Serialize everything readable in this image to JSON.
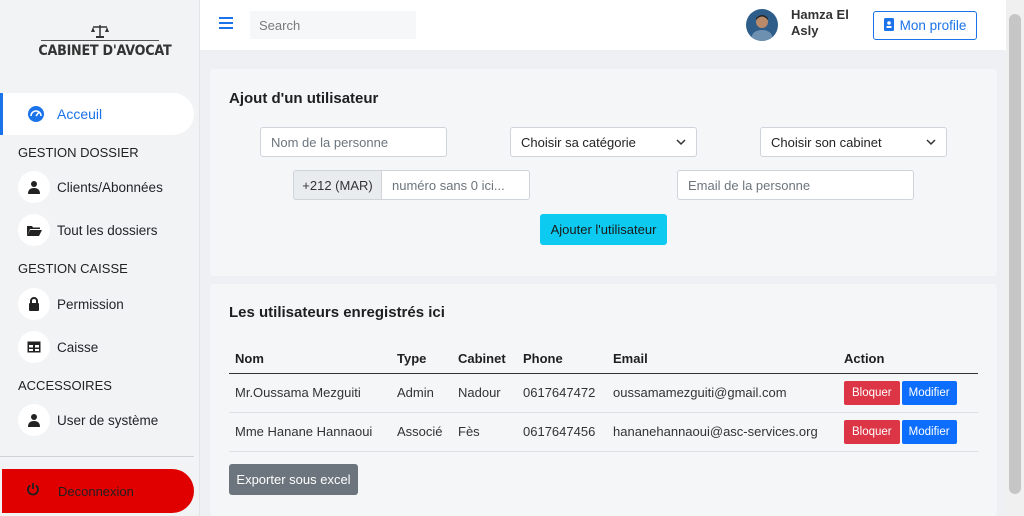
{
  "logo": {
    "text": "CABINET D'AVOCAT",
    "icon": "scales-icon"
  },
  "sidebar": {
    "active": {
      "label": "Acceuil",
      "icon": "dashboard-icon"
    },
    "sections": [
      {
        "title": "GESTION DOSSIER",
        "items": [
          {
            "label": "Clients/Abonnées",
            "icon": "user-icon"
          },
          {
            "label": "Tout les dossiers",
            "icon": "folder-open-icon"
          }
        ]
      },
      {
        "title": "GESTION CAISSE",
        "items": [
          {
            "label": "Permission",
            "icon": "lock-icon"
          },
          {
            "label": "Caisse",
            "icon": "table-icon"
          }
        ]
      },
      {
        "title": "ACCESSOIRES",
        "items": [
          {
            "label": "User de système",
            "icon": "user-icon"
          }
        ]
      }
    ],
    "logout": {
      "label": "Deconnexion",
      "icon": "power-icon"
    }
  },
  "topbar": {
    "search_placeholder": "Search",
    "user_name": "Hamza El Asly",
    "profile_label": "Mon profile",
    "accent": "#1a73e8"
  },
  "form": {
    "title": "Ajout d'un utilisateur",
    "name_placeholder": "Nom de la personne",
    "category_selected": "Choisir sa catégorie",
    "cabinet_selected": "Choisir son cabinet",
    "phone_prefix": "+212 (MAR)",
    "phone_placeholder": "numéro sans 0 ici...",
    "email_placeholder": "Email de la personne",
    "submit_label": "Ajouter l'utilisateur"
  },
  "users": {
    "title": "Les utilisateurs enregistrés ici",
    "columns": [
      "Nom",
      "Type",
      "Cabinet",
      "Phone",
      "Email",
      "Action"
    ],
    "rows": [
      {
        "nom": "Mr.Oussama Mezguiti",
        "type": "Admin",
        "cabinet": "Nadour",
        "phone": "0617647472",
        "email": "oussamamezguiti@gmail.com",
        "block": "Bloquer",
        "modify": "Modifier"
      },
      {
        "nom": "Mme Hanane Hannaoui",
        "type": "Associé",
        "cabinet": "Fès",
        "phone": "0617647456",
        "email": "hananehannaoui@asc-services.org",
        "block": "Bloquer",
        "modify": "Modifier"
      }
    ],
    "export_label": "Exporter sous excel"
  }
}
